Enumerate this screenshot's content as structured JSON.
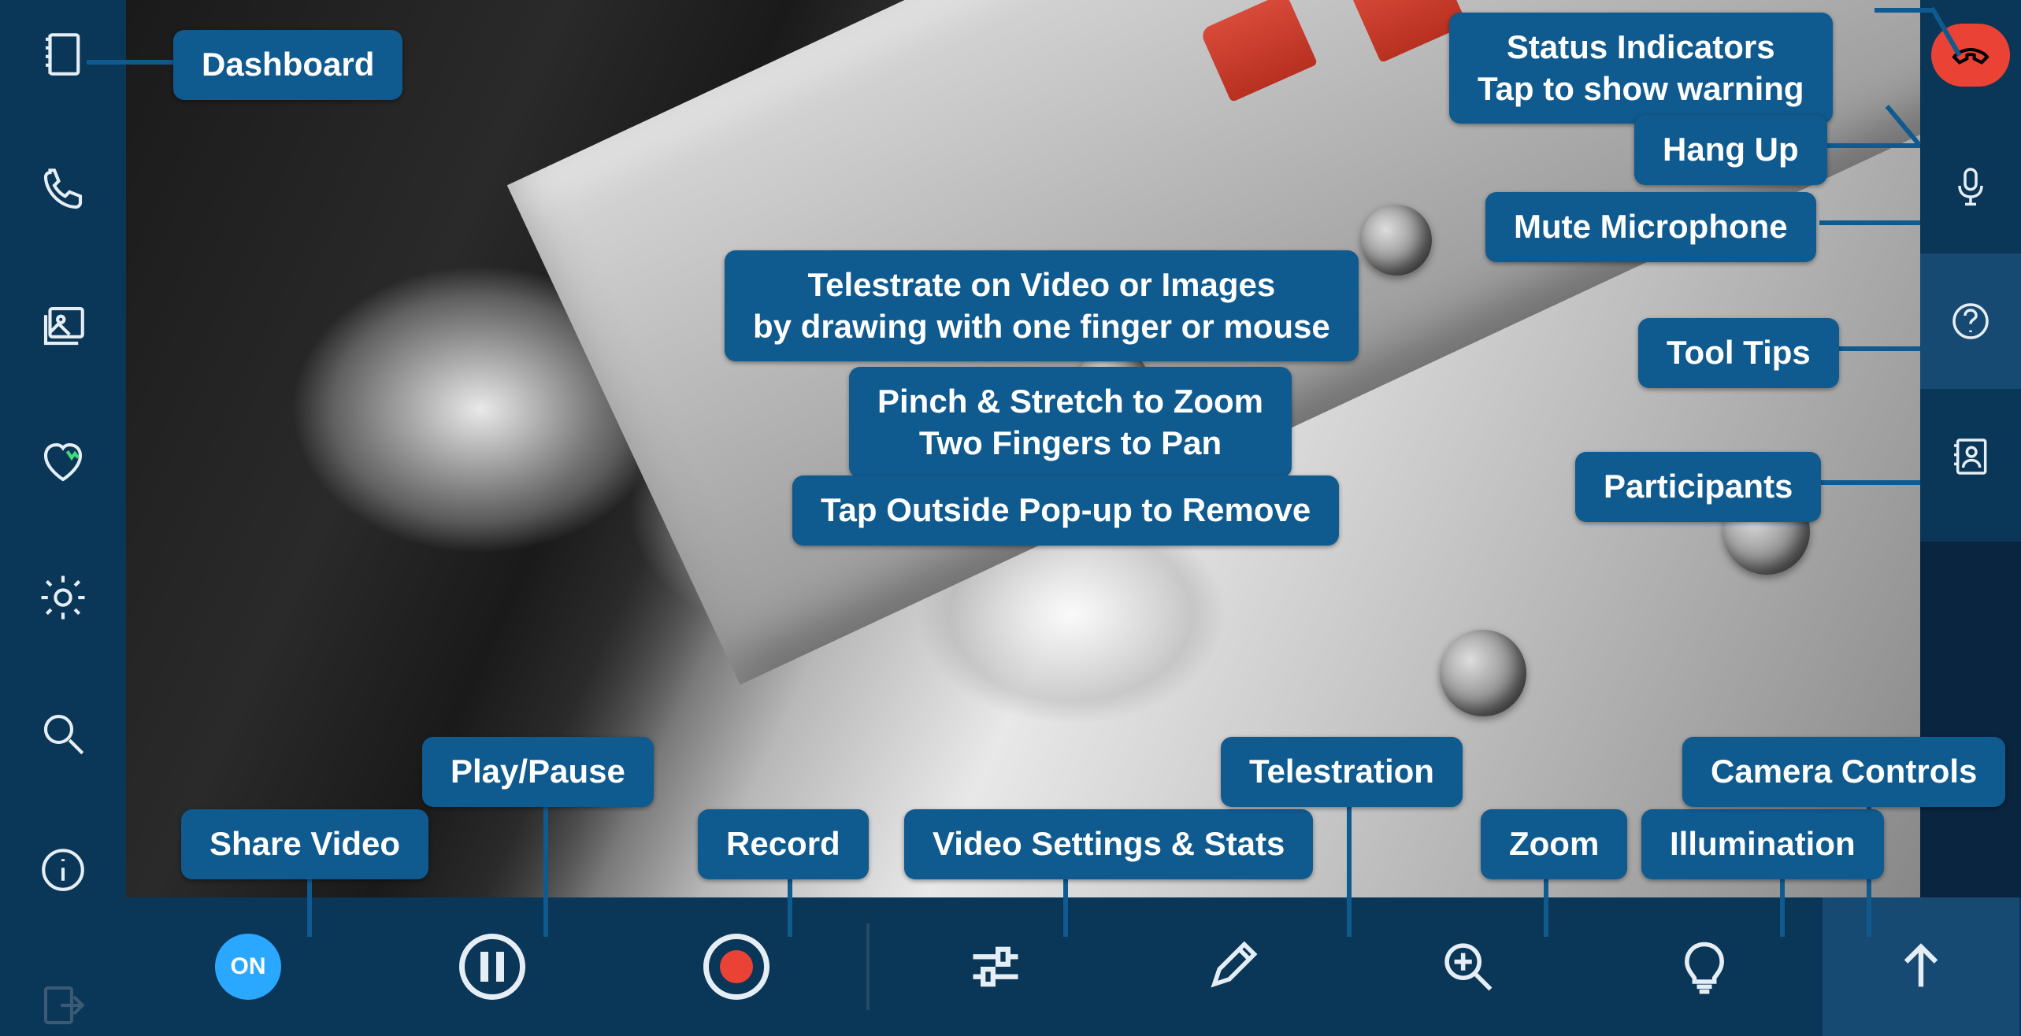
{
  "left_sidebar": {
    "items": [
      {
        "name": "dashboard",
        "icon": "book"
      },
      {
        "name": "call",
        "icon": "phone"
      },
      {
        "name": "gallery",
        "icon": "image-stack"
      },
      {
        "name": "health",
        "icon": "heart"
      },
      {
        "name": "settings",
        "icon": "gear"
      },
      {
        "name": "search",
        "icon": "magnifier"
      },
      {
        "name": "info",
        "icon": "info"
      },
      {
        "name": "exit",
        "icon": "exit",
        "disabled": true
      }
    ]
  },
  "right_sidebar": {
    "items": [
      {
        "name": "hangup",
        "icon": "phone-down"
      },
      {
        "name": "mute",
        "icon": "mic"
      },
      {
        "name": "tooltips",
        "icon": "help",
        "selected": true
      },
      {
        "name": "participants",
        "icon": "contacts"
      }
    ]
  },
  "bottom_bar": {
    "share_on_label": "ON",
    "items": [
      {
        "name": "share-video",
        "icon": "on-pill"
      },
      {
        "name": "play-pause",
        "icon": "pause"
      },
      {
        "name": "record",
        "icon": "record"
      },
      {
        "name": "video-settings",
        "icon": "sliders"
      },
      {
        "name": "telestration",
        "icon": "pencil"
      },
      {
        "name": "zoom",
        "icon": "zoom-in"
      },
      {
        "name": "illumination",
        "icon": "bulb"
      },
      {
        "name": "camera-controls",
        "icon": "arrow-up"
      }
    ]
  },
  "callouts": {
    "dashboard": "Dashboard",
    "status_indicators": "Status Indicators\nTap to show warning",
    "hang_up": "Hang Up",
    "mute_mic": "Mute Microphone",
    "tool_tips": "Tool Tips",
    "participants": "Participants",
    "telestrate": "Telestrate on Video or Images\nby drawing with one finger or mouse",
    "pinch": "Pinch & Stretch to Zoom\nTwo Fingers to Pan",
    "tap_outside": "Tap Outside Pop-up to Remove",
    "share_video": "Share Video",
    "play_pause": "Play/Pause",
    "record": "Record",
    "video_settings": "Video Settings & Stats",
    "telestration": "Telestration",
    "zoom": "Zoom",
    "illumination": "Illumination",
    "camera_controls": "Camera Controls"
  },
  "colors": {
    "sidebar_bg": "#0a3657",
    "callout_bg": "#0f5a8e",
    "hangup_bg": "#ea4335",
    "on_pill": "#2aa8ff",
    "record_dot": "#ea4335"
  }
}
